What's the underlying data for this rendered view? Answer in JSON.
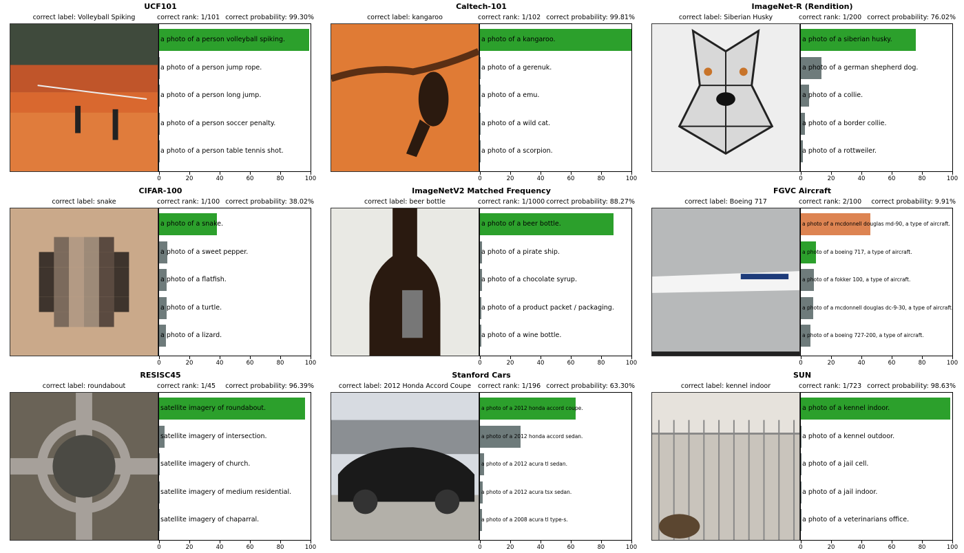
{
  "colors": {
    "correct": "#2ca02c",
    "wrong_top": "#dd8452",
    "other": "#6e7b7b"
  },
  "axis_ticks": [
    "0",
    "20",
    "40",
    "60",
    "80",
    "100"
  ],
  "chart_data": [
    {
      "type": "bar",
      "title": "UCF101",
      "correct_label": "correct label: Volleyball Spiking",
      "rank": "correct rank: 1/101",
      "probability": "correct probability: 99.30%",
      "image_icon": "volleyball-court-photo",
      "xlim": [
        0,
        100
      ],
      "label_size": "normal",
      "categories": [
        "a photo of a person volleyball spiking.",
        "a photo of a person jump rope.",
        "a photo of a person long jump.",
        "a photo of a person soccer penalty.",
        "a photo of a person table tennis shot."
      ],
      "values": [
        99.3,
        0.2,
        0.15,
        0.12,
        0.1
      ],
      "bar_status": [
        "correct",
        "other",
        "other",
        "other",
        "other"
      ]
    },
    {
      "type": "bar",
      "title": "Caltech-101",
      "correct_label": "correct label: kangaroo",
      "rank": "correct rank: 1/102",
      "probability": "correct probability: 99.81%",
      "image_icon": "kangaroo-photo",
      "xlim": [
        0,
        100
      ],
      "label_size": "normal",
      "categories": [
        "a photo of a kangaroo.",
        "a photo of a gerenuk.",
        "a photo of a emu.",
        "a photo of a wild cat.",
        "a photo of a scorpion."
      ],
      "values": [
        99.81,
        0.05,
        0.04,
        0.03,
        0.02
      ],
      "bar_status": [
        "correct",
        "other",
        "other",
        "other",
        "other"
      ]
    },
    {
      "type": "bar",
      "title": "ImageNet-R (Rendition)",
      "correct_label": "correct label: Siberian Husky",
      "rank": "correct rank: 1/200",
      "probability": "correct probability: 76.02%",
      "image_icon": "stained-glass-husky",
      "xlim": [
        0,
        100
      ],
      "label_size": "normal",
      "categories": [
        "a photo of a siberian husky.",
        "a photo of a german shepherd dog.",
        "a photo of a collie.",
        "a photo of a border collie.",
        "a photo of a rottweiler."
      ],
      "values": [
        76.02,
        13.5,
        5.5,
        2.5,
        1.5
      ],
      "bar_status": [
        "correct",
        "other",
        "other",
        "other",
        "other"
      ]
    },
    {
      "type": "bar",
      "title": "CIFAR-100",
      "correct_label": "correct label: snake",
      "rank": "correct rank: 1/100",
      "probability": "correct probability: 38.02%",
      "image_icon": "pixelated-snake",
      "xlim": [
        0,
        100
      ],
      "label_size": "normal",
      "categories": [
        "a photo of a snake.",
        "a photo of a sweet pepper.",
        "a photo of a flatfish.",
        "a photo of a turtle.",
        "a photo of a lizard."
      ],
      "values": [
        38.02,
        5.5,
        5.0,
        4.8,
        4.5
      ],
      "bar_status": [
        "correct",
        "other",
        "other",
        "other",
        "other"
      ]
    },
    {
      "type": "bar",
      "title": "ImageNetV2 Matched Frequency",
      "correct_label": "correct label: beer bottle",
      "rank": "correct rank: 1/1000",
      "probability": "correct probability: 88.27%",
      "image_icon": "beer-bottle-photo",
      "xlim": [
        0,
        100
      ],
      "label_size": "normal",
      "categories": [
        "a photo of a beer bottle.",
        "a photo of a pirate ship.",
        "a photo of a chocolate syrup.",
        "a photo of a product packet / packaging.",
        "a photo of a wine bottle."
      ],
      "values": [
        88.27,
        1.5,
        1.2,
        1.0,
        0.9
      ],
      "bar_status": [
        "correct",
        "other",
        "other",
        "other",
        "other"
      ]
    },
    {
      "type": "bar",
      "title": "FGVC Aircraft",
      "correct_label": "correct label: Boeing 717",
      "rank": "correct rank: 2/100",
      "probability": "correct probability: 9.91%",
      "image_icon": "aircraft-photo",
      "xlim": [
        0,
        100
      ],
      "label_size": "small",
      "categories": [
        "a photo of a mcdonnell douglas md-90, a type of aircraft.",
        "a photo of a boeing 717, a type of aircraft.",
        "a photo of a fokker 100, a type of aircraft.",
        "a photo of a mcdonnell douglas dc-9-30, a type of aircraft.",
        "a photo of a boeing 727-200, a type of aircraft."
      ],
      "values": [
        46.0,
        9.91,
        8.5,
        8.0,
        6.5
      ],
      "bar_status": [
        "wrong_top",
        "correct",
        "other",
        "other",
        "other"
      ]
    },
    {
      "type": "bar",
      "title": "RESISC45",
      "correct_label": "correct label: roundabout",
      "rank": "correct rank: 1/45",
      "probability": "correct probability: 96.39%",
      "image_icon": "satellite-roundabout",
      "xlim": [
        0,
        100
      ],
      "label_size": "normal",
      "categories": [
        "satellite imagery of roundabout.",
        "satellite imagery of intersection.",
        "satellite imagery of church.",
        "satellite imagery of medium residential.",
        "satellite imagery of chaparral."
      ],
      "values": [
        96.39,
        3.5,
        0.3,
        0.2,
        0.1
      ],
      "bar_status": [
        "correct",
        "other",
        "other",
        "other",
        "other"
      ]
    },
    {
      "type": "bar",
      "title": "Stanford Cars",
      "correct_label": "correct label: 2012 Honda Accord Coupe",
      "rank": "correct rank: 1/196",
      "probability": "correct probability: 63.30%",
      "image_icon": "car-photo",
      "xlim": [
        0,
        100
      ],
      "label_size": "small",
      "categories": [
        "a photo of a 2012 honda accord coupe.",
        "a photo of a 2012 honda accord sedan.",
        "a photo of a 2012 acura tl sedan.",
        "a photo of a 2012 acura tsx sedan.",
        "a photo of a 2008 acura tl type-s."
      ],
      "values": [
        63.3,
        27.0,
        2.5,
        2.0,
        1.5
      ],
      "bar_status": [
        "correct",
        "other",
        "other",
        "other",
        "other"
      ]
    },
    {
      "type": "bar",
      "title": "SUN",
      "correct_label": "correct label: kennel indoor",
      "rank": "correct rank: 1/723",
      "probability": "correct probability: 98.63%",
      "image_icon": "kennel-photo",
      "xlim": [
        0,
        100
      ],
      "label_size": "normal",
      "categories": [
        "a photo of a kennel indoor.",
        "a photo of a kennel outdoor.",
        "a photo of a jail cell.",
        "a photo of a jail indoor.",
        "a photo of a veterinarians office."
      ],
      "values": [
        98.63,
        0.6,
        0.3,
        0.2,
        0.1
      ],
      "bar_status": [
        "correct",
        "other",
        "other",
        "other",
        "other"
      ]
    }
  ]
}
